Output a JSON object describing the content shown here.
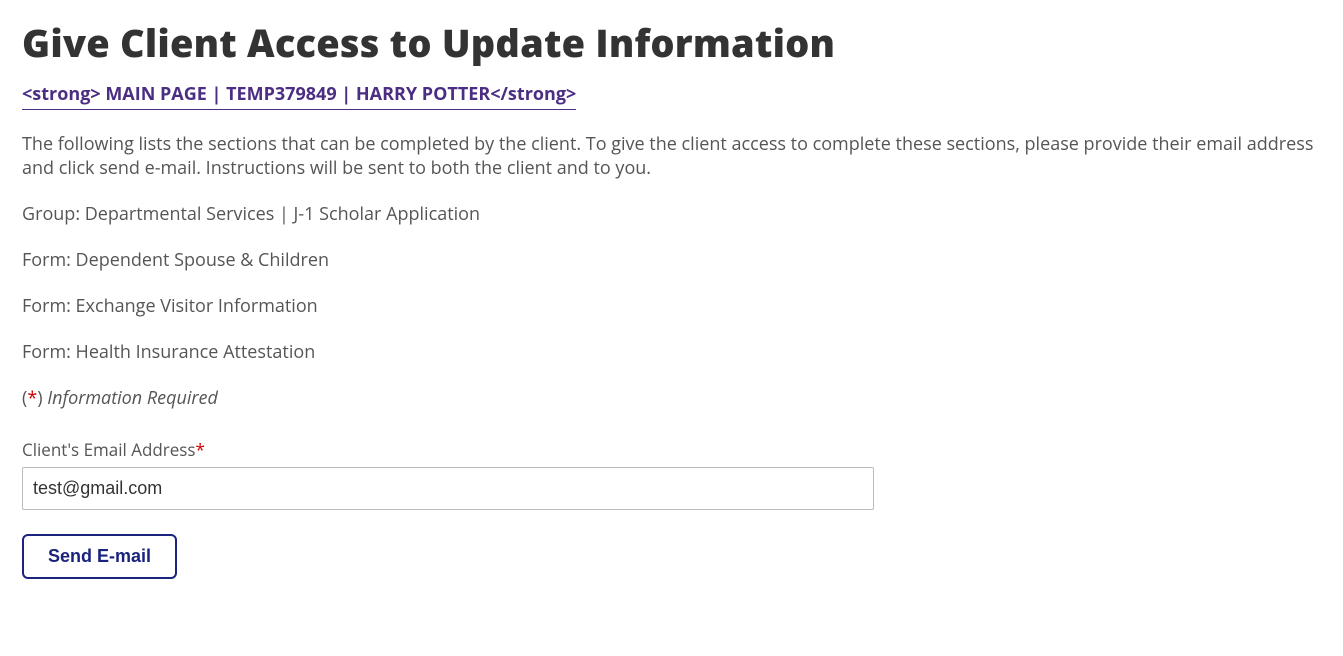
{
  "header": {
    "title": "Give Client Access to Update Information",
    "breadcrumb": "<strong> MAIN PAGE | TEMP379849 | HARRY POTTER</strong>"
  },
  "intro": "The following lists the sections that can be completed by the client. To give the client access to complete these sections, please provide their email address and click send e-mail. Instructions will be sent to both the client and to you.",
  "group_line": "Group: Departmental Services | J-1 Scholar Application",
  "forms": [
    "Form: Dependent Spouse & Children",
    "Form: Exchange Visitor Information",
    "Form: Health Insurance Attestation"
  ],
  "required_note": {
    "open": "(",
    "star": "*",
    "close": ")",
    "text": " Information Required"
  },
  "email_field": {
    "label": "Client's Email Address",
    "required_mark": "*",
    "value": "test@gmail.com"
  },
  "actions": {
    "send_label": "Send E-mail"
  }
}
